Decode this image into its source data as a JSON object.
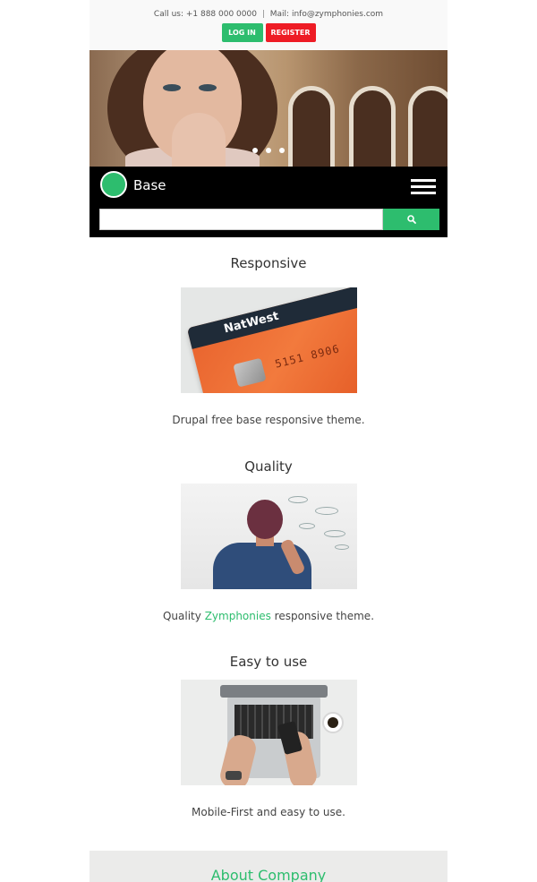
{
  "topbar": {
    "call_label": "Call us: +1 888 000 0000",
    "separator": "|",
    "mail_label": "Mail: info@zymphonies.com",
    "login_label": "LOG IN",
    "register_label": "REGISTER"
  },
  "slider": {
    "dots": 3,
    "active_index": 0
  },
  "header": {
    "site_name": "Base",
    "menu_icon": "hamburger-icon",
    "search": {
      "value": "",
      "placeholder": "",
      "button_icon": "search-icon"
    }
  },
  "features": [
    {
      "title": "Responsive",
      "image": "credit-card-image",
      "text": "Drupal free base responsive theme."
    },
    {
      "title": "Quality",
      "image": "whiteboard-image",
      "text_before": "Quality",
      "text_link": "Zymphonies",
      "text_after": "responsive theme."
    },
    {
      "title": "Easy to use",
      "image": "laptop-image",
      "text": "Mobile-First and easy to use."
    }
  ],
  "card_image": {
    "brand": "NatWest",
    "number": "5151 8906"
  },
  "about": {
    "title": "About Company"
  },
  "colors": {
    "accent": "#2dbd6e",
    "register": "#ee1c25",
    "header_bg": "#000000",
    "topbar_bg": "#f9f9f9"
  }
}
